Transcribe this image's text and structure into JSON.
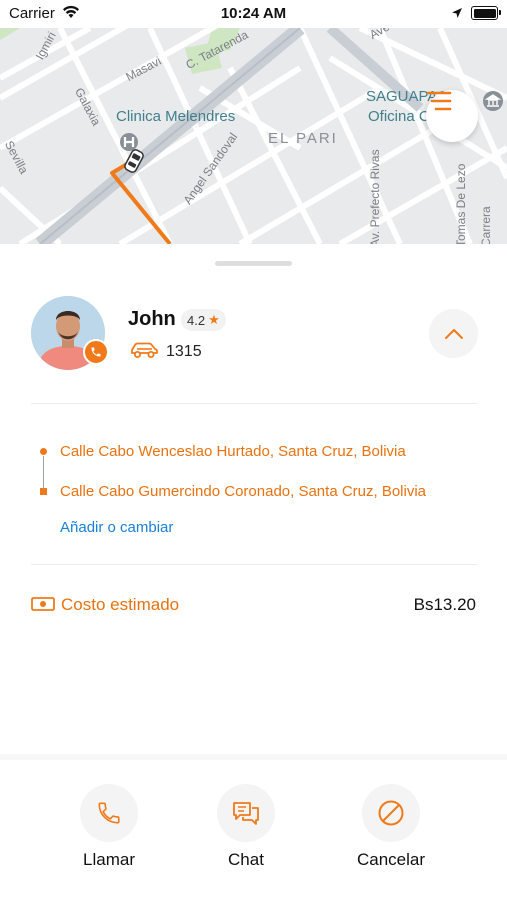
{
  "status_bar": {
    "carrier": "Carrier",
    "time": "10:24 AM"
  },
  "map": {
    "streets": [
      "Igmiri",
      "Masavi",
      "C. Tatarenda",
      "Galaxia",
      "Sevilla",
      "Angel Sandoval",
      "Av. Prefecto Rivas",
      "Tomas De Lezo",
      "Carrera",
      "Ave"
    ],
    "pois": {
      "clinic": "Clinica Melendres",
      "office_line1": "SAGUAPAC",
      "office_line2": "Oficina Central"
    },
    "area": "EL PARI"
  },
  "driver": {
    "name": "John",
    "rating": "4.2",
    "car_number": "1315"
  },
  "route": {
    "pickup": "Calle Cabo Wenceslao Hurtado, Santa Cruz, Bolivia",
    "dropoff": "Calle Cabo Gumercindo Coronado, Santa Cruz, Bolivia",
    "change_link": "Añadir o cambiar"
  },
  "cost": {
    "label": "Costo estimado",
    "value": "Bs13.20"
  },
  "actions": {
    "call": "Llamar",
    "chat": "Chat",
    "cancel": "Cancelar"
  },
  "colors": {
    "accent": "#f07a1a",
    "link": "#1a7fd8",
    "map_bg": "#e9eaec",
    "poi": "#3f7f8a"
  },
  "icons": [
    "wifi-icon",
    "location-arrow-icon",
    "battery-icon",
    "menu-icon",
    "phone-icon",
    "star-icon",
    "car-icon",
    "chevron-up-icon",
    "cash-icon",
    "chat-icon",
    "cancel-icon",
    "hospital-icon",
    "museum-icon"
  ]
}
